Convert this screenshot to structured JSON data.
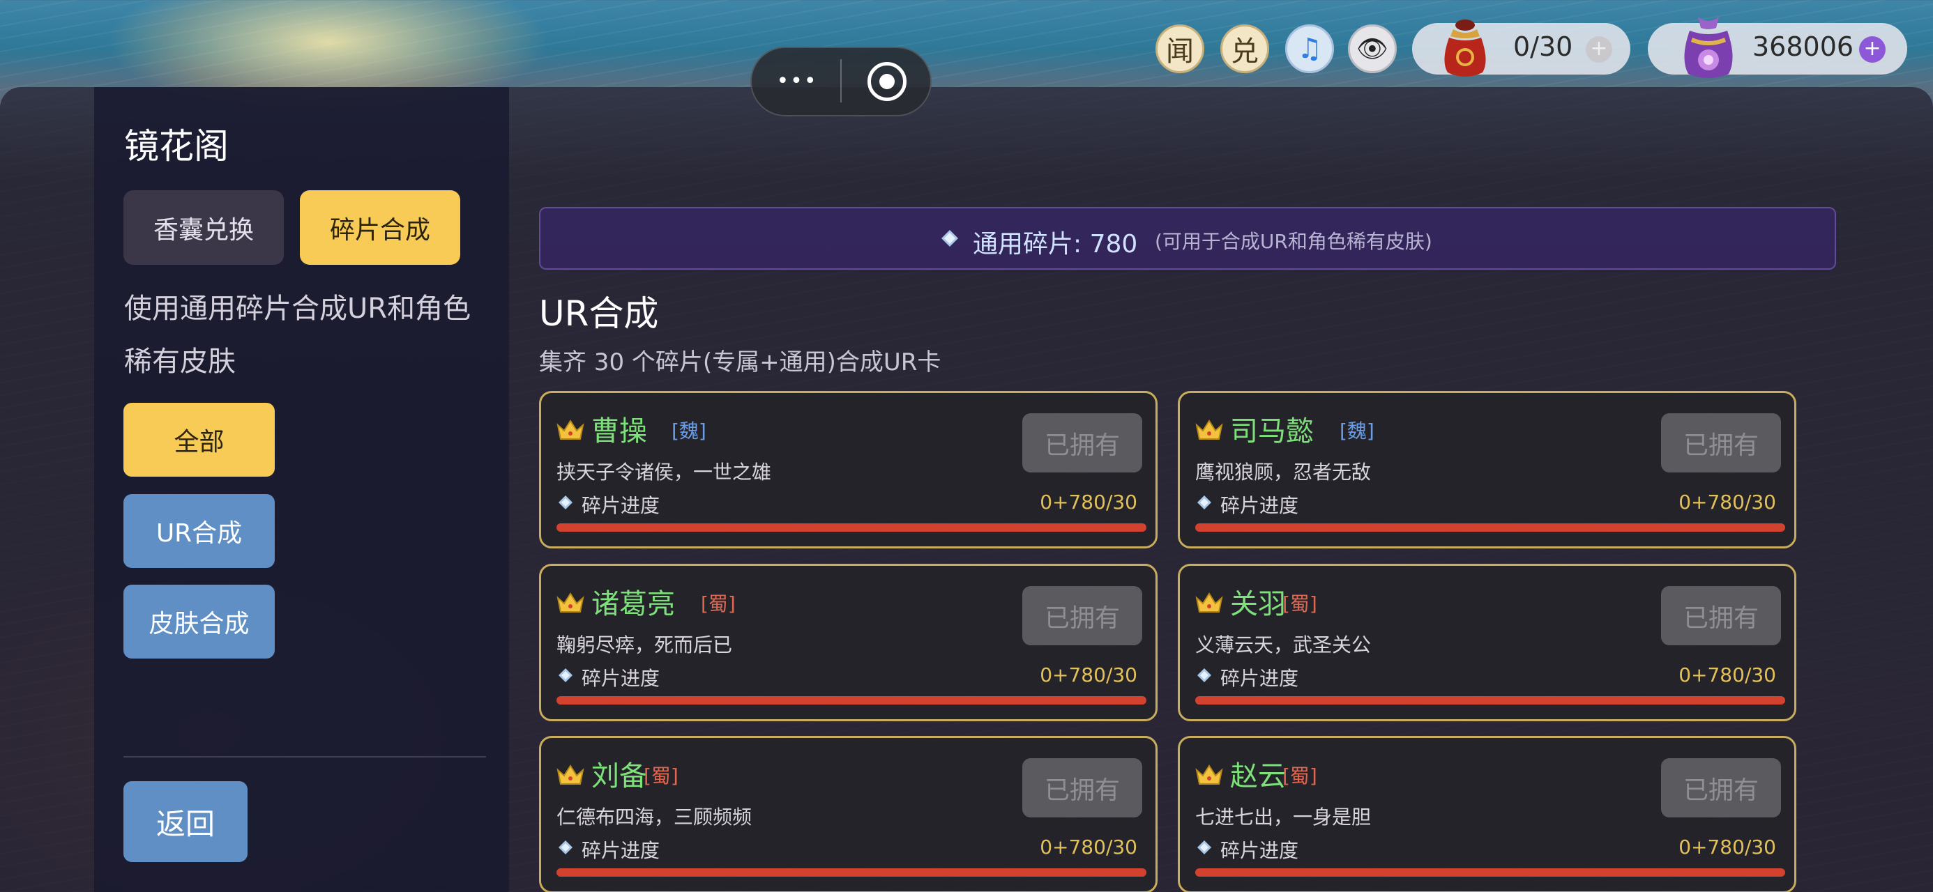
{
  "topbar": {
    "capsule_more": "•••",
    "btn_wen": "闻",
    "btn_dui": "兑",
    "music_icon": "♫",
    "eye_icon": "👁",
    "bag_count": "0/30",
    "coin_count": "368006",
    "plus": "+"
  },
  "sidebar": {
    "title": "镜花阁",
    "tabs": [
      {
        "label": "香囊兑换",
        "active": false
      },
      {
        "label": "碎片合成",
        "active": true
      }
    ],
    "description": "使用通用碎片合成UR和角色稀有皮肤",
    "filters": [
      {
        "label": "全部",
        "active": true
      },
      {
        "label": "UR合成",
        "active": false
      },
      {
        "label": "皮肤合成",
        "active": false
      }
    ],
    "back_label": "返回"
  },
  "main": {
    "banner_label": "通用碎片: 780",
    "banner_note": "(可用于合成UR和角色稀有皮肤)",
    "section_title": "UR合成",
    "section_subtitle": "集齐 30 个碎片(专属+通用)合成UR卡",
    "cards": [
      {
        "name": "曹操",
        "faction": "[魏]",
        "faction_color": "#6a9de6",
        "motto": "挟天子令诸侯，一世之雄",
        "progress_label": "碎片进度",
        "progress_value": "0+780/30",
        "progress_fraction": 1.0,
        "status": "已拥有"
      },
      {
        "name": "司马懿",
        "faction": "[魏]",
        "faction_color": "#6a9de6",
        "motto": "鹰视狼顾，忍者无敌",
        "progress_label": "碎片进度",
        "progress_value": "0+780/30",
        "progress_fraction": 1.0,
        "status": "已拥有"
      },
      {
        "name": "诸葛亮",
        "faction": "[蜀]",
        "faction_color": "#e0674f",
        "motto": "鞠躬尽瘁，死而后已",
        "progress_label": "碎片进度",
        "progress_value": "0+780/30",
        "progress_fraction": 1.0,
        "status": "已拥有"
      },
      {
        "name": "关羽",
        "faction": "[蜀]",
        "faction_color": "#e0674f",
        "motto": "义薄云天，武圣关公",
        "progress_label": "碎片进度",
        "progress_value": "0+780/30",
        "progress_fraction": 1.0,
        "status": "已拥有"
      },
      {
        "name": "刘备",
        "faction": "[蜀]",
        "faction_color": "#e0674f",
        "motto": "仁德布四海，三顾频频",
        "progress_label": "碎片进度",
        "progress_value": "0+780/30",
        "progress_fraction": 1.0,
        "status": "已拥有"
      },
      {
        "name": "赵云",
        "faction": "[蜀]",
        "faction_color": "#e0674f",
        "motto": "七进七出，一身是胆",
        "progress_label": "碎片进度",
        "progress_value": "0+780/30",
        "progress_fraction": 1.0,
        "status": "已拥有"
      }
    ]
  },
  "colors": {
    "accent_yellow": "#f7cb55",
    "button_blue": "#5f8fc4",
    "card_border": "#c9ad5e",
    "name_green": "#7ee07a",
    "progress_red": "#d3412f"
  }
}
